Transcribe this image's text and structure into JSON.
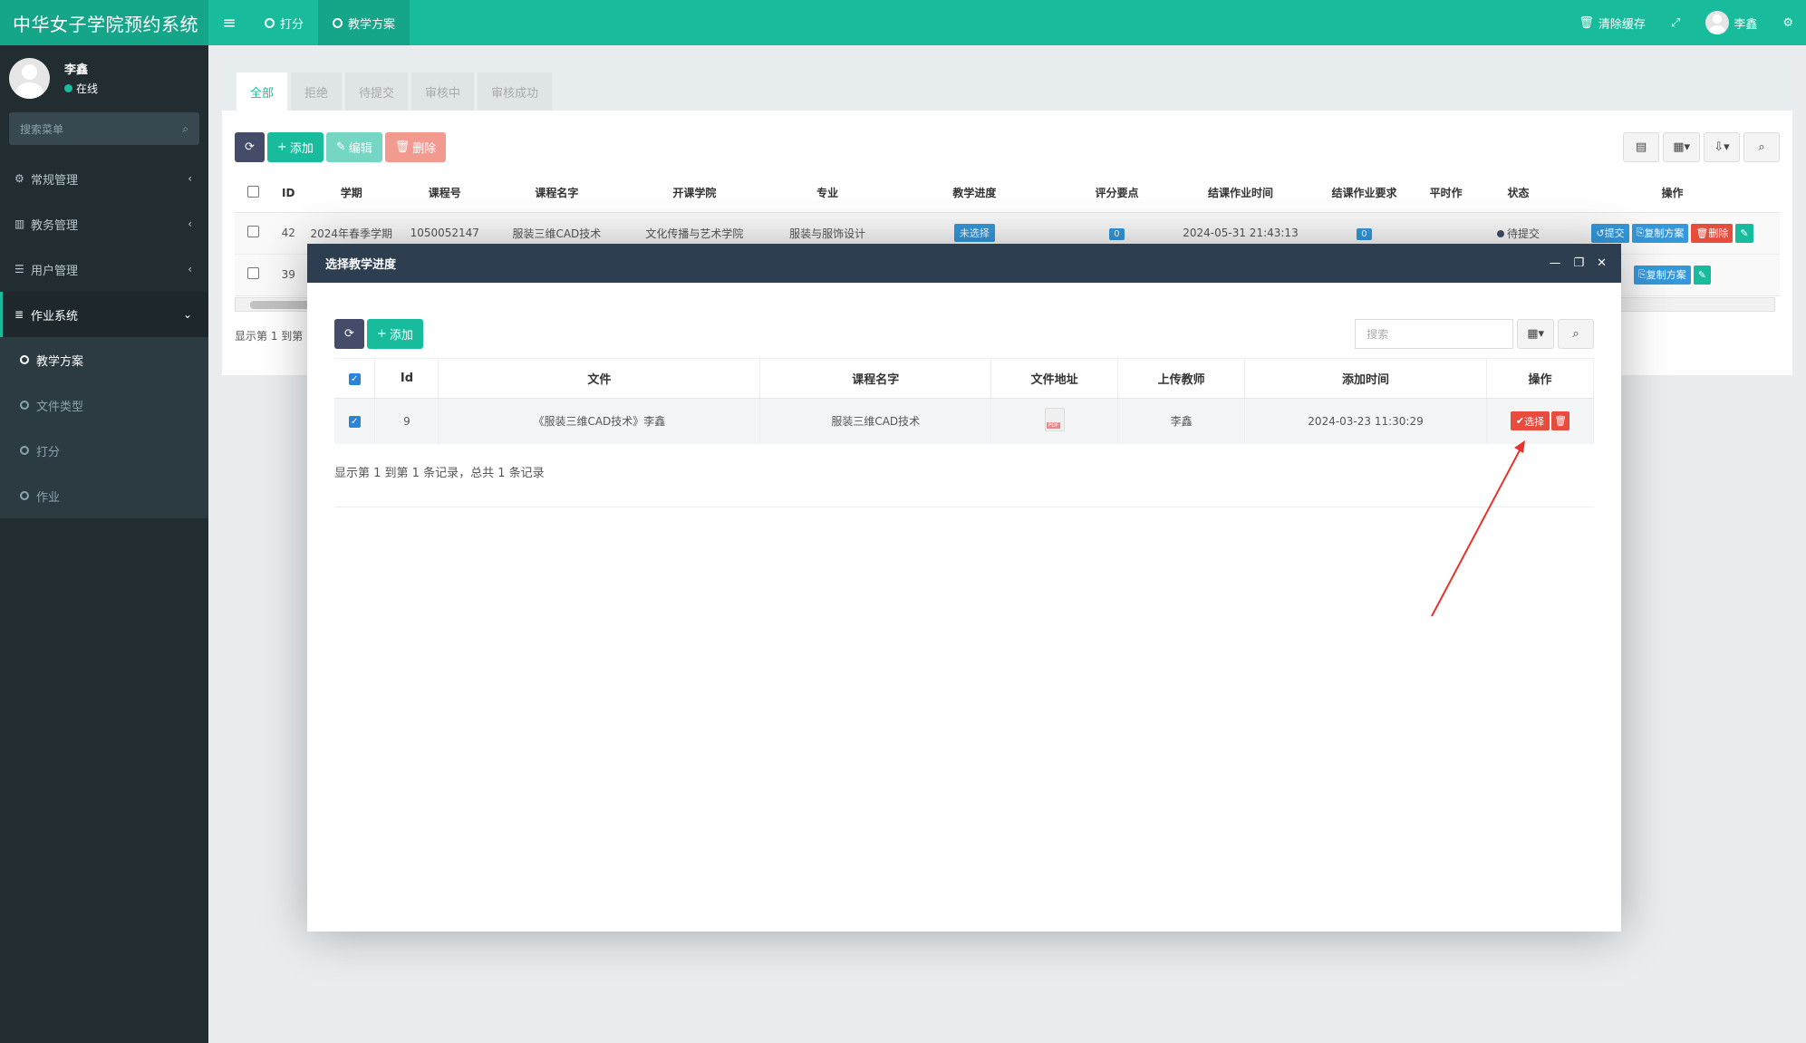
{
  "app": {
    "title": "中华女子学院预约系统"
  },
  "topnav": {
    "tabs": [
      {
        "label": "打分"
      },
      {
        "label": "教学方案"
      }
    ],
    "clear_cache": "清除缓存",
    "user": "李鑫"
  },
  "sidebar": {
    "user_name": "李鑫",
    "user_status": "在线",
    "search_placeholder": "搜索菜单",
    "menus": [
      {
        "label": "常规管理"
      },
      {
        "label": "教务管理"
      },
      {
        "label": "用户管理"
      },
      {
        "label": "作业系统"
      }
    ],
    "submenu": [
      {
        "label": "教学方案"
      },
      {
        "label": "文件类型"
      },
      {
        "label": "打分"
      },
      {
        "label": "作业"
      }
    ]
  },
  "content": {
    "tabs": [
      {
        "label": "全部"
      },
      {
        "label": "拒绝"
      },
      {
        "label": "待提交"
      },
      {
        "label": "审核中"
      },
      {
        "label": "审核成功"
      }
    ],
    "toolbar": {
      "add": "添加",
      "edit": "编辑",
      "delete": "删除"
    },
    "columns": [
      "ID",
      "学期",
      "课程号",
      "课程名字",
      "开课学院",
      "专业",
      "教学进度",
      "评分要点",
      "结课作业时间",
      "结课作业要求",
      "平时作",
      "状态",
      "操作"
    ],
    "rows": [
      {
        "id": "42",
        "term": "2024年春季学期",
        "course_no": "1050052147",
        "course_name": "服装三维CAD技术",
        "college": "文化传播与艺术学院",
        "major": "服装与服饰设计",
        "progress": "未选择",
        "score_points": "0",
        "end_time": "2024-05-31 21:43:13",
        "requirement": "0",
        "status": "待提交",
        "ops": {
          "submit": "提交",
          "copy": "复制方案",
          "delete": "删除"
        }
      },
      {
        "id": "39",
        "ops": {
          "copy": "复制方案"
        }
      }
    ],
    "summary": "显示第 1 到第"
  },
  "modal": {
    "title": "选择教学进度",
    "toolbar": {
      "add": "添加"
    },
    "search_placeholder": "搜索",
    "columns": [
      "Id",
      "文件",
      "课程名字",
      "文件地址",
      "上传教师",
      "添加时间",
      "操作"
    ],
    "rows": [
      {
        "id": "9",
        "file": "《服装三维CAD技术》李鑫",
        "course_name": "服装三维CAD技术",
        "teacher": "李鑫",
        "added": "2024-03-23 11:30:29",
        "select_label": "选择"
      }
    ],
    "summary": "显示第 1 到第 1 条记录，总共 1 条记录"
  },
  "colors": {
    "primary": "#18bc9c",
    "sidebar": "#222d32",
    "modal_header": "#2c3e50",
    "danger": "#e74c3c",
    "info": "#3498db",
    "annotation_arrow": "#e8332a"
  }
}
